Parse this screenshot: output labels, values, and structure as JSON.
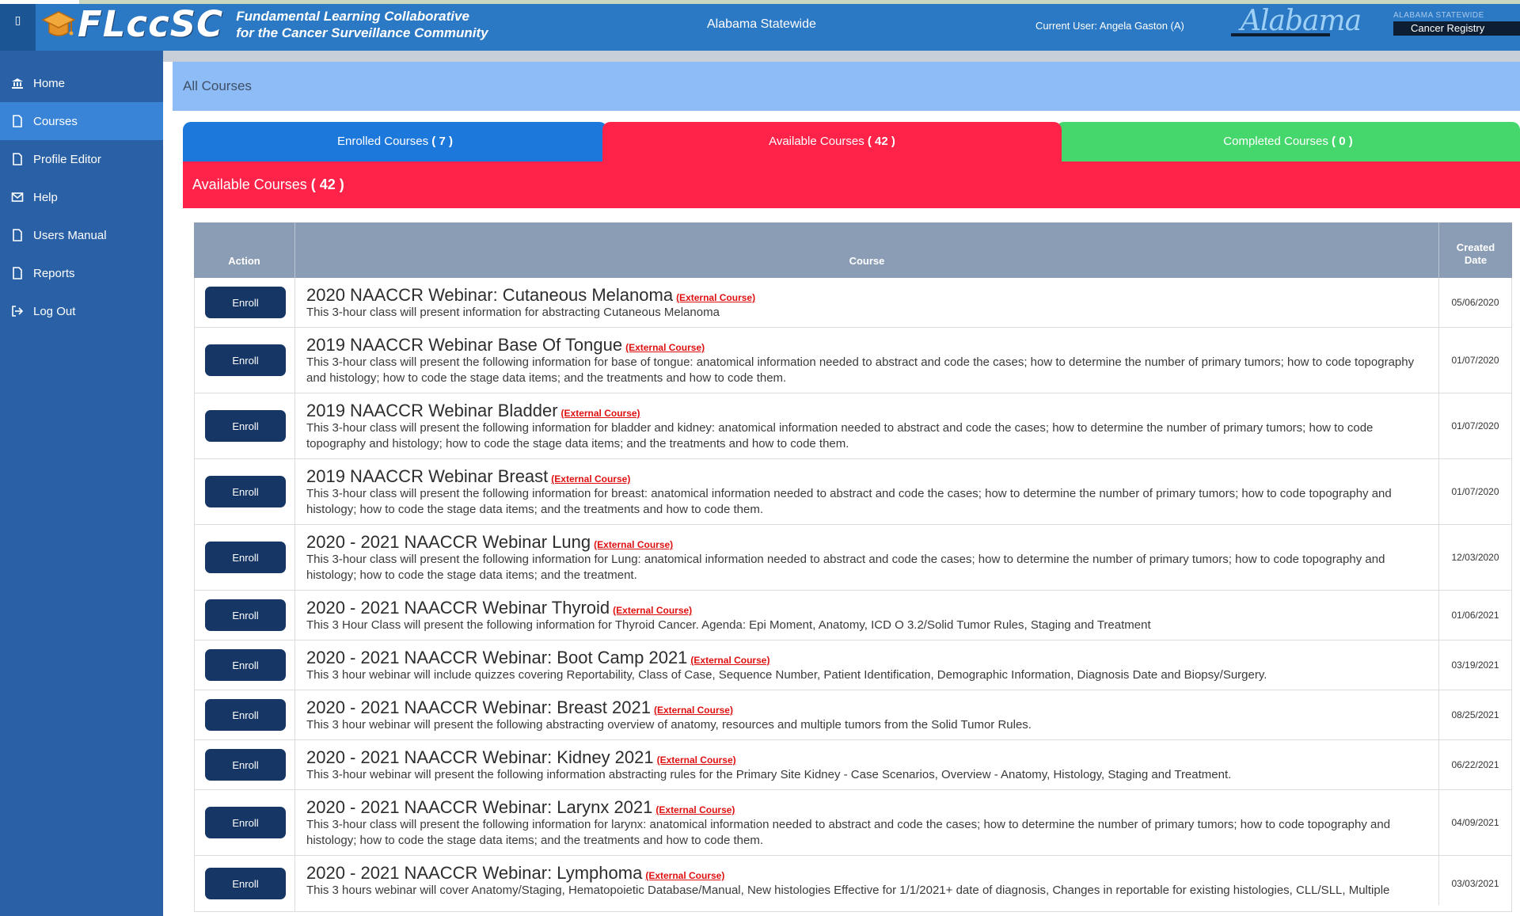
{
  "header": {
    "menu_glyph": "▯",
    "brand": "FLccSC",
    "tagline_1": "Fundamental Learning Collaborative",
    "tagline_2": "for the Cancer Surveillance Community",
    "statewide": "Alabama Statewide",
    "current_user": "Current User: Angela Gaston (A)",
    "state_script": "Alabama",
    "registry_small": "ALABAMA STATEWIDE",
    "registry_big": "Cancer Registry"
  },
  "sidebar": {
    "items": [
      {
        "label": "Home",
        "icon": "bank-icon"
      },
      {
        "label": "Courses",
        "icon": "file-icon"
      },
      {
        "label": "Profile Editor",
        "icon": "file-icon"
      },
      {
        "label": "Help",
        "icon": "envelope-icon"
      },
      {
        "label": "Users Manual",
        "icon": "file-icon"
      },
      {
        "label": "Reports",
        "icon": "file-icon"
      },
      {
        "label": "Log Out",
        "icon": "sign-out-icon"
      }
    ],
    "active_index": 1
  },
  "breadcrumb": "All Courses",
  "tabs": {
    "enrolled_label": "Enrolled Courses",
    "enrolled_count": "( 7 )",
    "available_label": "Available Courses",
    "available_count": "( 42 )",
    "completed_label": "Completed Courses",
    "completed_count": "( 0 )"
  },
  "section": {
    "title": "Available Courses",
    "count": "( 42 )"
  },
  "table": {
    "headers": {
      "action": "Action",
      "course": "Course",
      "created_1": "Created",
      "created_2": "Date"
    },
    "button_label": "Enroll",
    "external_label": "(External Course)",
    "rows": [
      {
        "title": "2020 NAACCR Webinar: Cutaneous Melanoma",
        "desc": "This 3-hour class will present information for abstracting Cutaneous Melanoma",
        "date": "05/06/2020"
      },
      {
        "title": "2019 NAACCR Webinar Base Of Tongue",
        "desc": "This 3-hour class will present the following information for base of tongue: anatomical information needed to abstract and code the cases; how to determine the number of primary tumors; how to code topography and histology; how to code the stage data items; and the treatments and how to code them.",
        "date": "01/07/2020"
      },
      {
        "title": "2019 NAACCR Webinar Bladder",
        "desc": "This 3-hour class will present the following information for bladder and kidney: anatomical information needed to abstract and code the cases; how to determine the number of primary tumors; how to code topography and histology; how to code the stage data items; and the treatments and how to code them.",
        "date": "01/07/2020"
      },
      {
        "title": "2019 NAACCR Webinar Breast",
        "desc": "This 3-hour class will present the following information for breast: anatomical information needed to abstract and code the cases; how to determine the number of primary tumors; how to code topography and histology; how to code the stage data items; and the treatments and how to code them.",
        "date": "01/07/2020"
      },
      {
        "title": "2020 - 2021 NAACCR Webinar Lung",
        "desc": "This 3-hour class will present the following information for Lung: anatomical information needed to abstract and code the cases; how to determine the number of primary tumors; how to code topography and histology; how to code the stage data items; and the treatment.",
        "date": "12/03/2020"
      },
      {
        "title": "2020 - 2021 NAACCR Webinar Thyroid",
        "desc": "This 3 Hour Class will present the following information for Thyroid Cancer. Agenda: Epi Moment, Anatomy, ICD O 3.2/Solid Tumor Rules, Staging and Treatment",
        "date": "01/06/2021"
      },
      {
        "title": "2020 - 2021 NAACCR Webinar: Boot Camp 2021",
        "desc": "This 3 hour webinar will include quizzes covering Reportability, Class of Case, Sequence Number, Patient Identification, Demographic Information, Diagnosis Date and Biopsy/Surgery.",
        "date": "03/19/2021"
      },
      {
        "title": "2020 - 2021 NAACCR Webinar: Breast 2021",
        "desc": "This 3 hour webinar will present the following abstracting overview of anatomy, resources and multiple tumors from the Solid Tumor Rules.",
        "date": "08/25/2021"
      },
      {
        "title": "2020 - 2021 NAACCR Webinar: Kidney 2021",
        "desc": "This 3-hour webinar will present the following information abstracting rules for the Primary Site Kidney - Case Scenarios, Overview - Anatomy, Histology, Staging and Treatment.",
        "date": "06/22/2021"
      },
      {
        "title": "2020 - 2021 NAACCR Webinar: Larynx 2021",
        "desc": "This 3-hour class will present the following information for larynx: anatomical information needed to abstract and code the cases; how to determine the number of primary tumors; how to code topography and histology; how to code the stage data items; and the treatments and how to code them.",
        "date": "04/09/2021"
      },
      {
        "title": "2020 - 2021 NAACCR Webinar: Lymphoma",
        "desc": "This 3 hours webinar will cover Anatomy/Staging, Hematopoietic Database/Manual, New histologies Effective for 1/1/2021+ date of diagnosis, Changes in reportable for existing histologies, CLL/SLL, Multiple",
        "date": "03/03/2021"
      }
    ]
  },
  "colors": {
    "header_blue": "#2b78c4",
    "sidebar_blue": "#2a61a6",
    "tab_enrolled": "#1d78dc",
    "tab_available": "#ff2349",
    "tab_completed": "#45d66c",
    "button_navy": "#163766",
    "external_red": "#e01010"
  }
}
